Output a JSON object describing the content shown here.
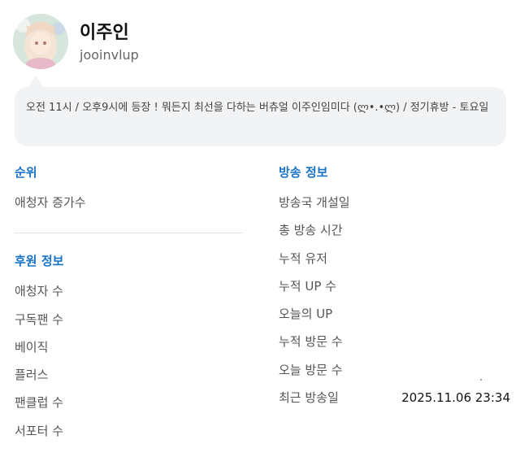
{
  "profile": {
    "name": "이주인",
    "handle": "jooinvlup",
    "bio": "오전 11시 / 오후9시에 등장 ! 뭐든지 최선을 다하는 버츄얼 이주인임미다 (ლ•.•ლ) / 정기휴방 - 토요일"
  },
  "rank": {
    "title": "순위",
    "items": [
      {
        "label": "애청자 증가수",
        "value": ""
      }
    ]
  },
  "support": {
    "title": "후원 정보",
    "items": [
      {
        "label": "애청자 수",
        "value": ""
      },
      {
        "label": "구독팬 수",
        "value": ""
      },
      {
        "label": "베이직",
        "value": ""
      },
      {
        "label": "플러스",
        "value": ""
      },
      {
        "label": "팬클럽 수",
        "value": ""
      },
      {
        "label": "서포터 수",
        "value": ""
      }
    ]
  },
  "broadcast": {
    "title": "방송 정보",
    "items": [
      {
        "label": "방송국 개설일",
        "value": ""
      },
      {
        "label": "총 방송 시간",
        "value": ""
      },
      {
        "label": "누적 유저",
        "value": ""
      },
      {
        "label": "누적 UP 수",
        "value": ""
      },
      {
        "label": "오늘의 UP",
        "value": ""
      },
      {
        "label": "누적 방문 수",
        "value": ""
      },
      {
        "label": "오늘 방문 수",
        "value": ""
      },
      {
        "label": "최근 방송일",
        "value": "2025.11.06 23:34"
      }
    ]
  },
  "colors": {
    "accent": "#1a73c9",
    "bubble": "#f2f3f5"
  }
}
